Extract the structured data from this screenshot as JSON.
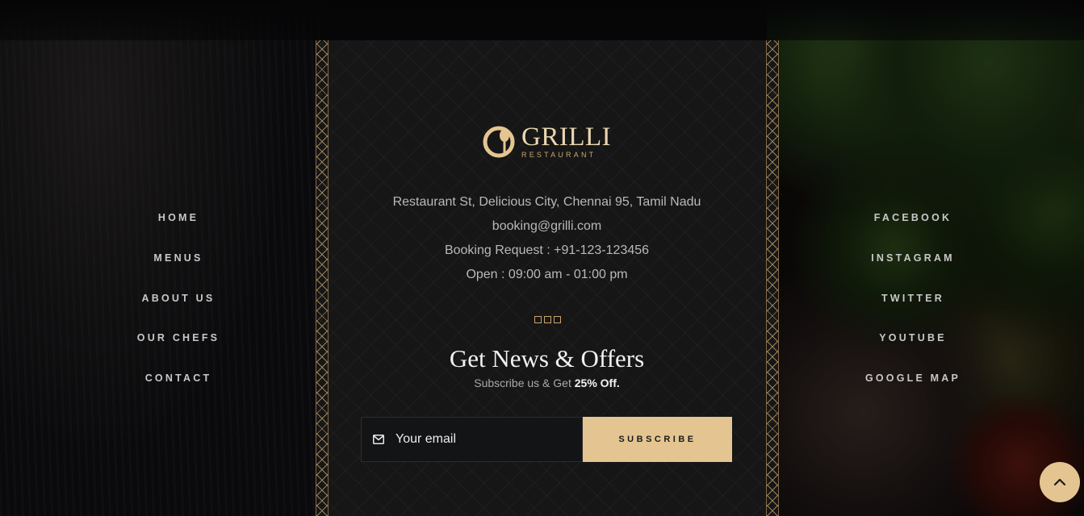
{
  "brand": {
    "name": "GRILLI",
    "tagline": "RESTAURANT"
  },
  "contact": {
    "address": "Restaurant St, Delicious City, Chennai 95, Tamil Nadu",
    "email": "booking@grilli.com",
    "booking": "Booking Request : +91-123-123456",
    "hours": "Open : 09:00 am - 01:00 pm"
  },
  "newsletter": {
    "title": "Get News & Offers",
    "subtitle_prefix": "Subscribe us & Get ",
    "subtitle_highlight": "25% Off.",
    "email_placeholder": "Your email",
    "button_label": "SUBSCRIBE"
  },
  "nav_left": [
    "HOME",
    "MENUS",
    "ABOUT US",
    "OUR CHEFS",
    "CONTACT"
  ],
  "nav_right": [
    "FACEBOOK",
    "INSTAGRAM",
    "TWITTER",
    "YOUTUBE",
    "GOOGLE MAP"
  ],
  "icons": {
    "mail": "mail-icon",
    "back_to_top": "chevron-up-icon",
    "logo": "spoon-plate-icon"
  },
  "colors": {
    "accent": "#e4c591",
    "panel": "#161616",
    "text_muted": "#b9b9b9"
  }
}
